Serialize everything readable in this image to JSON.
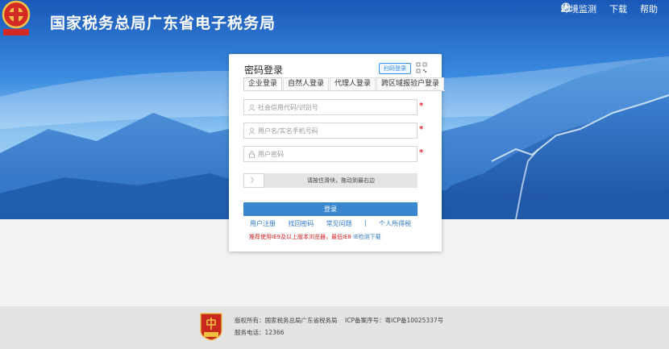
{
  "header": {
    "site_title": "国家税务总局广东省电子税务局",
    "emblem_text": "中国税务",
    "links": [
      {
        "label": "环境监测",
        "icon": "tool-icon"
      },
      {
        "label": "下载",
        "icon": "download-icon"
      },
      {
        "label": "帮助",
        "icon": "help-circle-icon"
      }
    ]
  },
  "login": {
    "title": "密码登录",
    "qr_tag": "扫码登录",
    "tabs": [
      "企业登录",
      "自然人登录",
      "代理人登录",
      "跨区域报验户登录"
    ],
    "active_tab": "企业登录",
    "fields": {
      "credit_code_placeholder": "社会信用代码/识别号",
      "username_placeholder": "用户名/实名手机号码",
      "password_placeholder": "用户密码"
    },
    "required_mark": "*",
    "slider_handle": "》",
    "slider_text": "请按住滑块，拖动到最右边",
    "submit_label": "登录",
    "links": {
      "register": "用户注册",
      "recover": "找回密码",
      "faq": "常见问题",
      "separator": "|",
      "personal_tax": "个人所得税"
    },
    "notice_text": "推荐使用IE9及以上版本浏览器，最低IE8 ",
    "notice_link": "IE检测下载"
  },
  "footer": {
    "copyright": "版权所有：国家税务总局广东省税务局",
    "icp": "ICP备案序号：粤ICP备10025337号",
    "phone": "服务电话：12366",
    "badge_text": "党政机关"
  },
  "colors": {
    "primary": "#3a87cf",
    "link": "#2f7ad0",
    "warning": "#d52020"
  }
}
